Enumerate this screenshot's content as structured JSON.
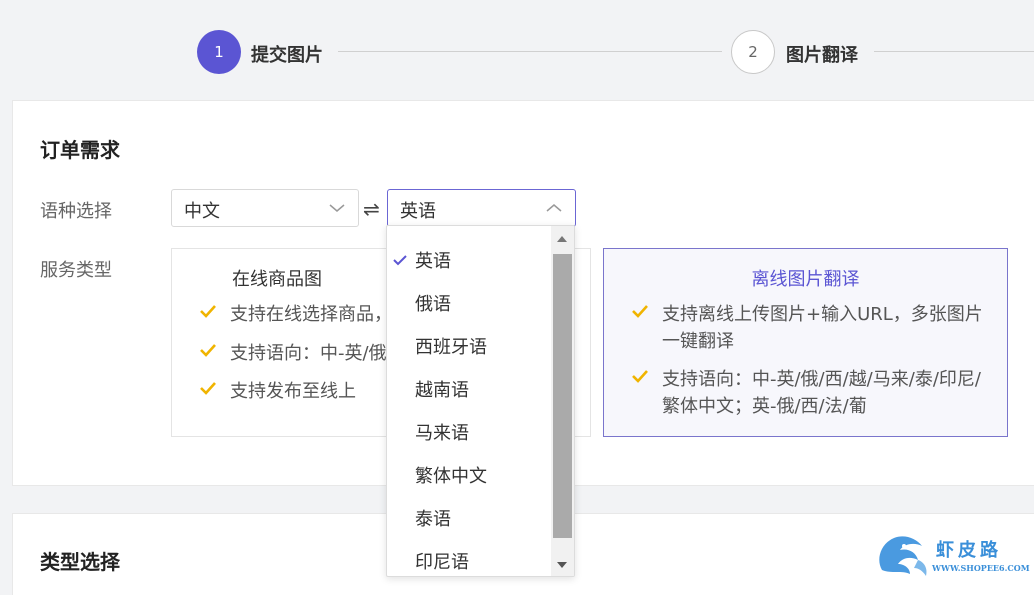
{
  "stepper": {
    "steps": [
      {
        "number": "1",
        "label": "提交图片",
        "active": true
      },
      {
        "number": "2",
        "label": "图片翻译",
        "active": false
      }
    ]
  },
  "order": {
    "title": "订单需求",
    "language_label": "语种选择",
    "source_lang": "中文",
    "target_lang": "英语",
    "swap_symbol": "⇌",
    "service_label": "服务类型"
  },
  "services": {
    "online": {
      "title": "在线商品图",
      "features": [
        "支持在线选择商品，",
        "支持语向：中-英/俄",
        "支持发布至线上"
      ]
    },
    "offline": {
      "title": "离线图片翻译",
      "features": [
        "支持离线上传图片+输入URL，多张图片一键翻译",
        "支持语向：中-英/俄/西/越/马来/泰/印尼/繁体中文；英-俄/西/法/葡"
      ]
    }
  },
  "dropdown": {
    "options": [
      "英语",
      "俄语",
      "西班牙语",
      "越南语",
      "马来语",
      "繁体中文",
      "泰语",
      "印尼语"
    ],
    "selected": "英语"
  },
  "type_section": {
    "title": "类型选择"
  },
  "watermark": {
    "text": "虾皮路",
    "url": "WWW.SHOPEE6.COM"
  },
  "colors": {
    "accent": "#5b55d3",
    "check": "#f0b400",
    "border_active": "#7a75cc"
  }
}
